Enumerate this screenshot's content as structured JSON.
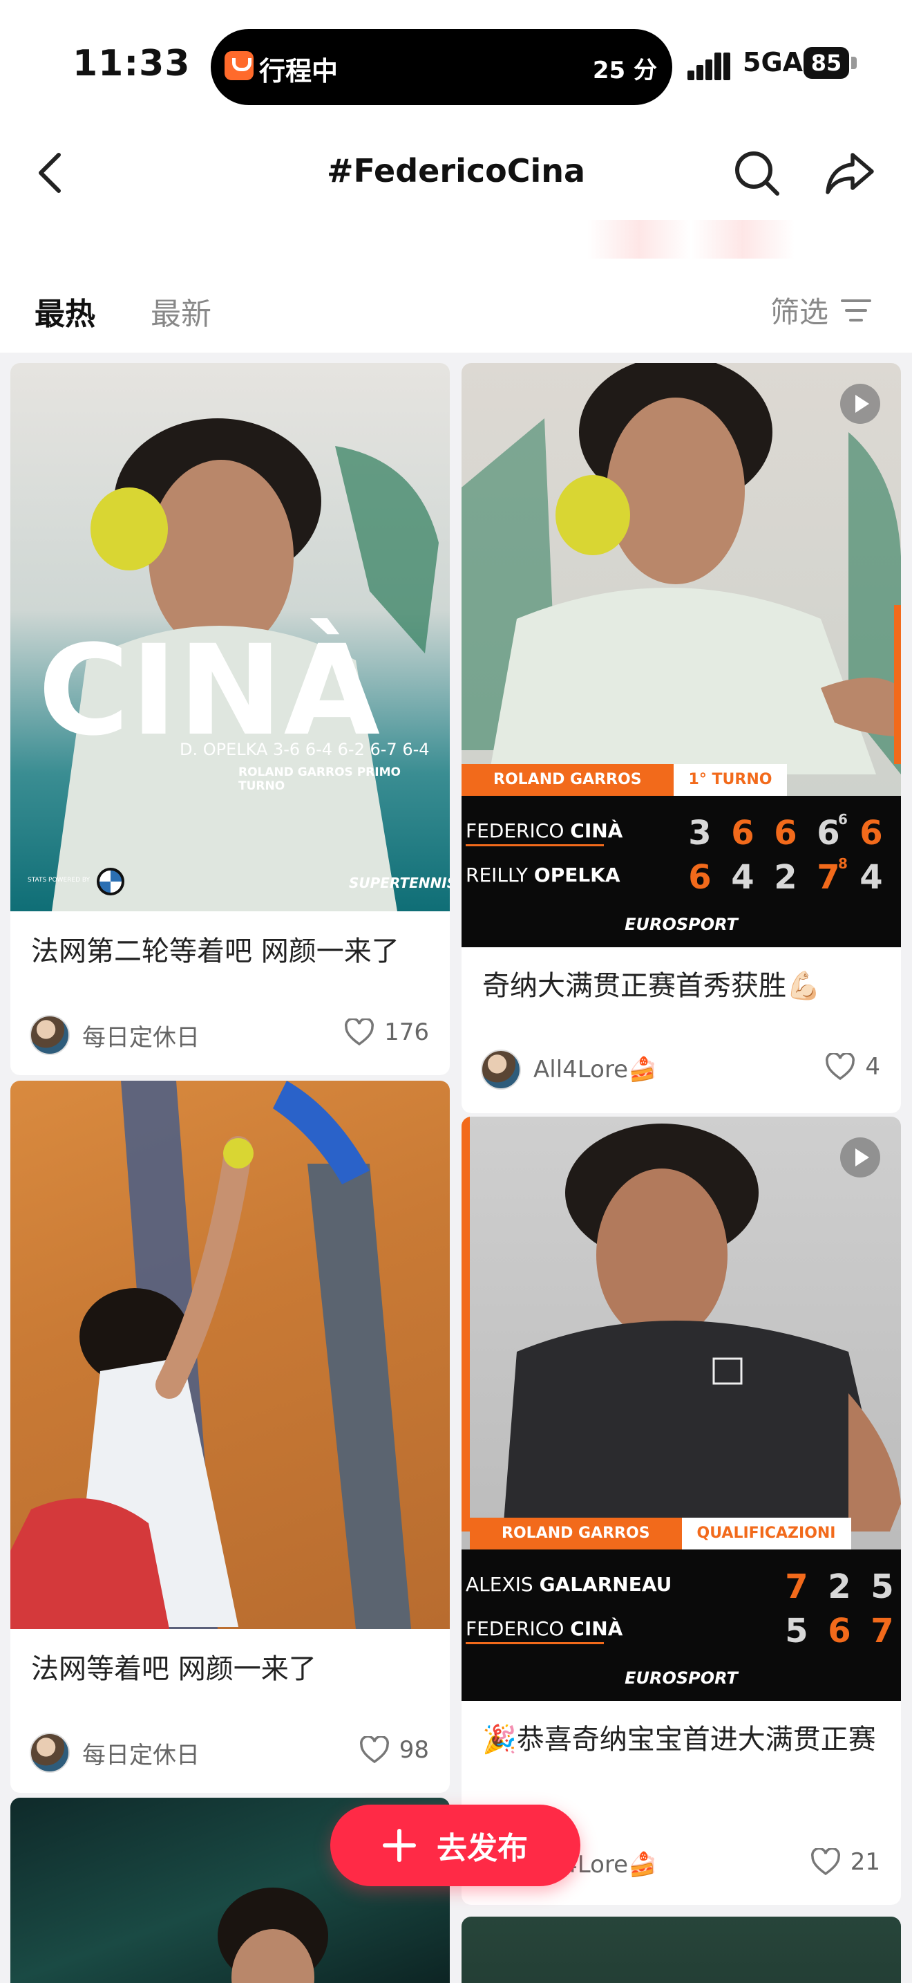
{
  "status_bar": {
    "time": "11:33",
    "island_app_label": "行程中",
    "island_eta": "25 分",
    "network": "5GA",
    "battery": "85"
  },
  "nav": {
    "title": "#FedericoCina",
    "icons": [
      "back-icon",
      "search-icon",
      "share-icon"
    ]
  },
  "tabs": {
    "hot": "最热",
    "latest": "最新",
    "filter": "筛选"
  },
  "cards": [
    {
      "title": "法网第二轮等着吧 网颜一来了",
      "author": "每日定休日",
      "likes": "176",
      "image": {
        "headline": "CINÀ",
        "result": "D. OPELKA 3-6 6-4 6-2 6-7 6-4",
        "round": "ROLAND GARROS PRIMO TURNO",
        "credit": "STATS POWERED BY",
        "brand": "SUPERTENNIS"
      }
    },
    {
      "title": "奇纳大满贯正赛首秀获胜💪🏻",
      "author": "All4Lore🍰",
      "likes": "4",
      "image": {
        "tag_left": "ROLAND GARROS",
        "tag_right": "1° TURNO",
        "player1_first": "FEDERICO ",
        "player1_last": "CINÀ",
        "player1_scores": [
          "3",
          "6",
          "6",
          "6",
          "6"
        ],
        "player1_tiebreak": "6",
        "player2_first": "REILLY ",
        "player2_last": "OPELKA",
        "player2_scores": [
          "6",
          "4",
          "2",
          "7",
          "4"
        ],
        "player2_tiebreak": "8",
        "broadcaster": "EUROSPORT"
      }
    },
    {
      "title": "法网等着吧 网颜一来了",
      "author": "每日定休日",
      "likes": "98"
    },
    {
      "title": "🎉恭喜奇纳宝宝首进大满贯正赛",
      "author": "All4Lore🍰",
      "likes": "21",
      "image": {
        "tag_left": "ROLAND GARROS",
        "tag_right": "QUALIFICAZIONI",
        "player1_first": "ALEXIS ",
        "player1_last": "GALARNEAU",
        "player1_scores": [
          "7",
          "2",
          "5"
        ],
        "player2_first": "FEDERICO ",
        "player2_last": "CINÀ",
        "player2_scores": [
          "5",
          "6",
          "7"
        ],
        "broadcaster": "EUROSPORT"
      }
    }
  ],
  "fab": {
    "label": "去发布"
  }
}
